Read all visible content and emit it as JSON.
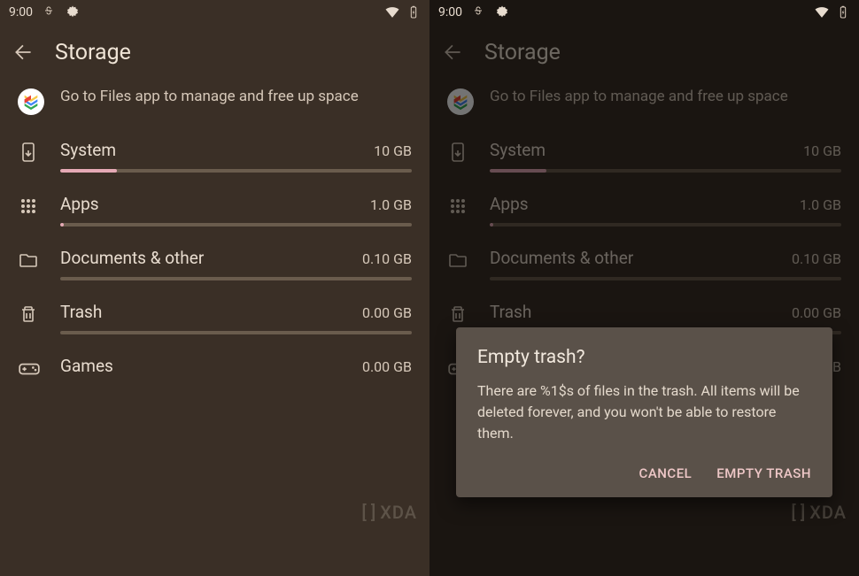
{
  "status": {
    "time": "9:00"
  },
  "page": {
    "title": "Storage",
    "files_hint": "Go to Files app to manage and free up space"
  },
  "cats": [
    {
      "name": "System",
      "size": "10 GB",
      "fill": 16
    },
    {
      "name": "Apps",
      "size": "1.0 GB",
      "fill": 1
    },
    {
      "name": "Documents & other",
      "size": "0.10 GB",
      "fill": 0
    },
    {
      "name": "Trash",
      "size": "0.00 GB",
      "fill": 0
    },
    {
      "name": "Games",
      "size": "0.00 GB",
      "fill": 0
    }
  ],
  "dialog": {
    "title": "Empty trash?",
    "message": "There are %1$s of files in the trash. All items will be deleted forever, and you won't be able to restore them.",
    "cancel": "CANCEL",
    "confirm": "EMPTY TRASH"
  },
  "watermark": "XDA"
}
